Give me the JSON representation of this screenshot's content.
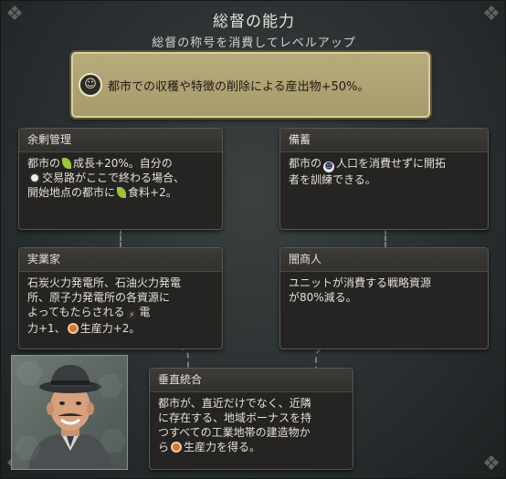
{
  "panel": {
    "title": "総督の能力",
    "subtitle": "総督の称号を消費してレベルアップ"
  },
  "banner": {
    "icon": "governor-seal-icon",
    "text": "都市での収穫や特徴の削除による産出物+50%。"
  },
  "cards": {
    "surplus": {
      "title": "余剰管理",
      "l1a": "都市の",
      "l1b": "成長+20%。自分の",
      "l2": "交易路がここで終わる場合、",
      "l3a": "開始地点の都市に",
      "l3b": "食料+2。"
    },
    "reserves": {
      "title": "備蓄",
      "l1a": "都市の",
      "l1b": "人口を消費せずに開拓",
      "l2": "者を訓練できる。"
    },
    "industrialist": {
      "title": "実業家",
      "l1": "石炭火力発電所、石油火力発電",
      "l2": "所、原子力発電所の各資源に",
      "l3a": "よってもたらされる",
      "l3b": "電",
      "l4a": "力+1、",
      "l4b": "生産力+2。"
    },
    "black_marketeer": {
      "title": "闇商人",
      "l1": "ユニットが消費する戦略資源",
      "l2": "が80%減る。"
    },
    "vertical_integration": {
      "title": "垂直統合",
      "l1": "都市が、直近だけでなく、近隣",
      "l2": "に存在する、地域ボーナスを持",
      "l3": "つすべての工業地帯の建造物か",
      "l4a": "ら",
      "l4b": "生産力を得る。"
    }
  },
  "icons": {
    "growth": "leaf-icon",
    "trade": "trade-route-icon",
    "food": "food-icon",
    "citizen": "citizen-icon",
    "power": "power-icon",
    "production": "production-icon"
  },
  "colors": {
    "banner": "#b0a474",
    "card_bg": "#252423",
    "text": "#e4e0d6"
  }
}
